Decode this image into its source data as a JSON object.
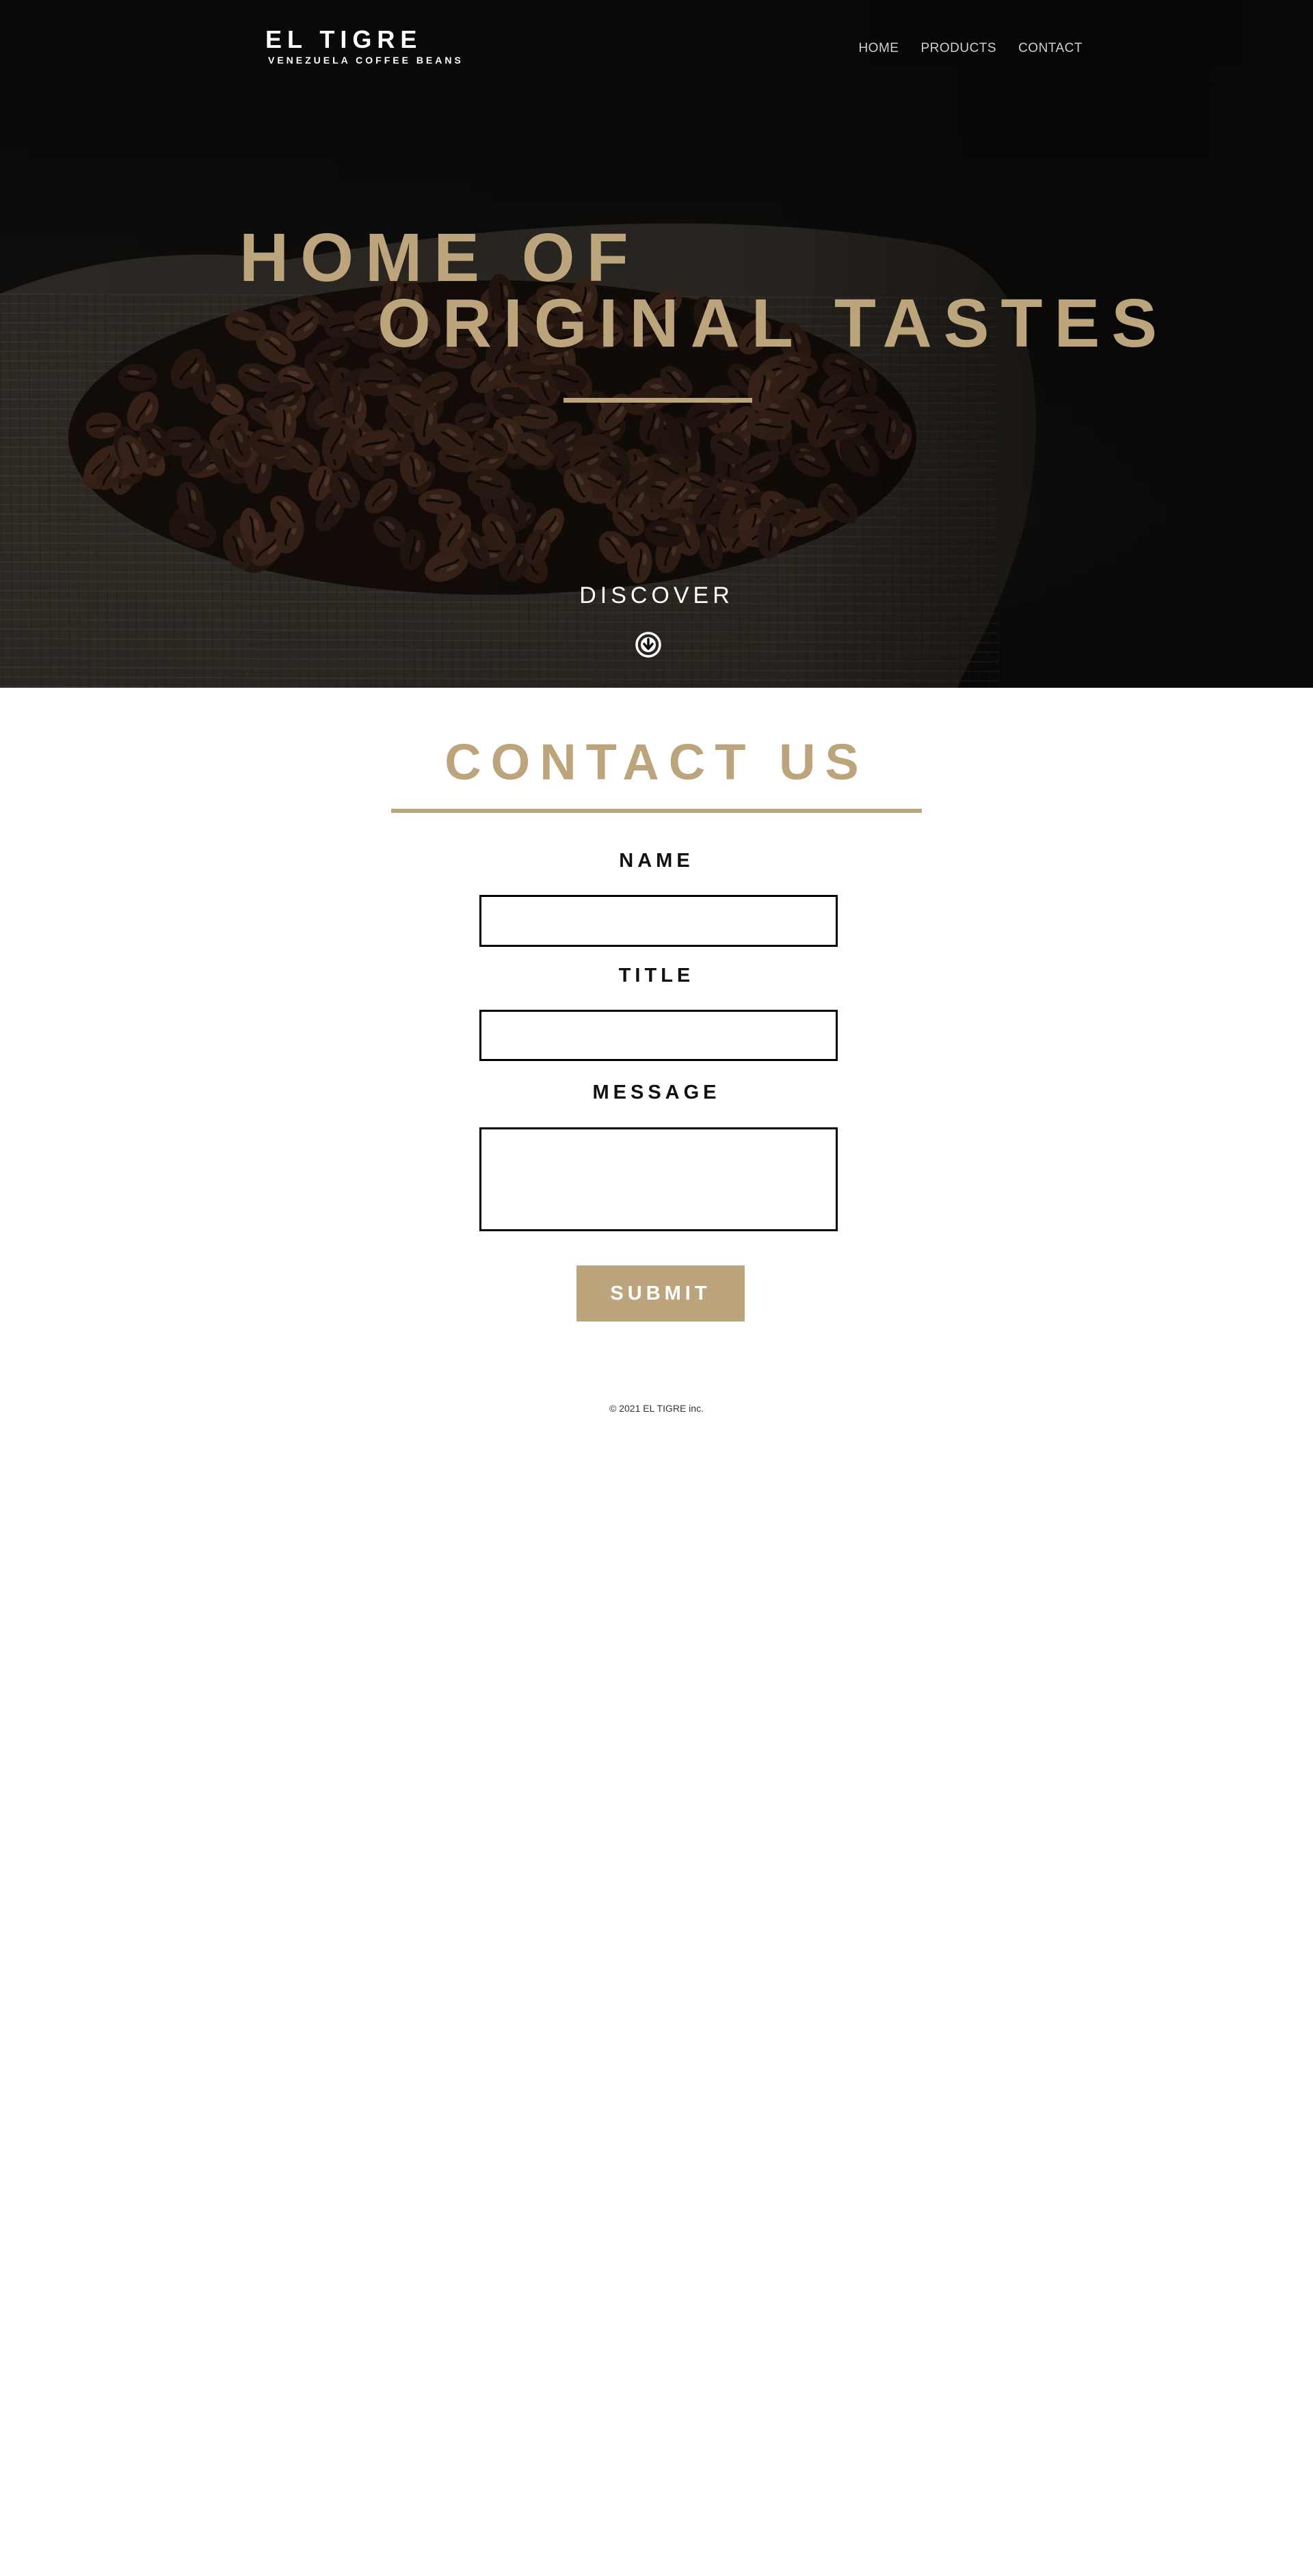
{
  "header": {
    "brand_name": "EL TIGRE",
    "brand_tagline": "VENEZUELA COFFEE BEANS",
    "nav": [
      {
        "label": "HOME"
      },
      {
        "label": "PRODUCTS"
      },
      {
        "label": "CONTACT"
      }
    ]
  },
  "hero": {
    "line1": "HOME OF",
    "line2": "ORIGINAL TASTES",
    "discover_label": "DISCOVER",
    "discover_icon": "arrow-down-circle-icon",
    "image_subject": "coffee-beans-in-burlap-sack"
  },
  "contact": {
    "title": "CONTACT US",
    "fields": [
      {
        "label": "NAME",
        "value": "",
        "placeholder": ""
      },
      {
        "label": "TITLE",
        "value": "",
        "placeholder": ""
      },
      {
        "label": "MESSAGE",
        "value": "",
        "placeholder": ""
      }
    ],
    "submit_label": "SUBMIT"
  },
  "footer": {
    "copyright": "© 2021 EL TIGRE inc."
  },
  "colors": {
    "accent": "#bca47d",
    "hero_background": "#0b0b0b",
    "page_background": "#ffffff",
    "text_dark": "#111111"
  }
}
